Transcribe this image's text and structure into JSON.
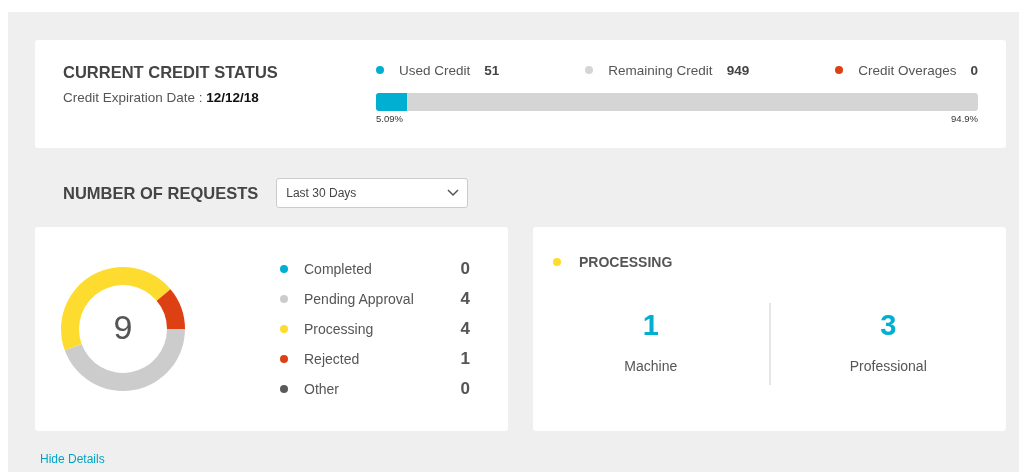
{
  "credit_status": {
    "title": "CURRENT CREDIT STATUS",
    "expiration_label": "Credit Expiration Date :",
    "expiration_date": "12/12/18",
    "legend": [
      {
        "label": "Used Credit",
        "value": "51",
        "color": "#00afd1"
      },
      {
        "label": "Remaining Credit",
        "value": "949",
        "color": "#d5d5d5"
      },
      {
        "label": "Credit Overages",
        "value": "0",
        "color": "#dd4013"
      }
    ],
    "bar": {
      "level": 0.0509,
      "left_label": "5.09%",
      "right_label": "94.9%"
    }
  },
  "requests": {
    "title": "NUMBER OF REQUESTS",
    "period": {
      "value": "Last 30 Days"
    },
    "total": "9",
    "legend": [
      {
        "label": "Completed",
        "value": "0",
        "color": "#00afd1"
      },
      {
        "label": "Pending Approval",
        "value": "4",
        "color": "#cccccc"
      },
      {
        "label": "Processing",
        "value": "4",
        "color": "#fddc2f"
      },
      {
        "label": "Rejected",
        "value": "1",
        "color": "#dd4013"
      },
      {
        "label": "Other",
        "value": "0",
        "color": "#5a5a5a"
      }
    ]
  },
  "processing": {
    "title": "PROCESSING",
    "color": "#fddc2f",
    "stats": [
      {
        "value": "1",
        "label": "Machine"
      },
      {
        "value": "3",
        "label": "Professional"
      }
    ]
  },
  "hide_details": "Hide Details"
}
